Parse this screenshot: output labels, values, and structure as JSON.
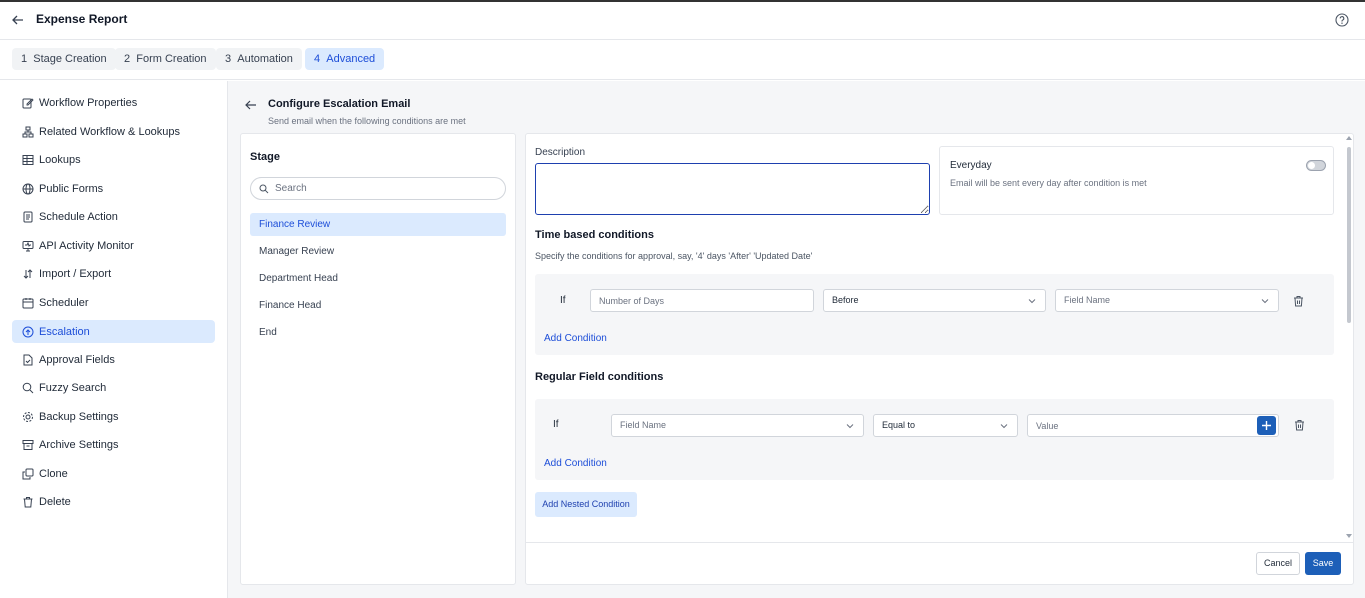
{
  "header": {
    "title": "Expense Report"
  },
  "steps": [
    {
      "num": "1",
      "label": "Stage Creation"
    },
    {
      "num": "2",
      "label": "Form Creation"
    },
    {
      "num": "3",
      "label": "Automation"
    },
    {
      "num": "4",
      "label": "Advanced"
    }
  ],
  "sidebar": {
    "items": [
      {
        "label": "Workflow Properties",
        "icon": "edit-icon"
      },
      {
        "label": "Related Workflow & Lookups",
        "icon": "hierarchy-icon"
      },
      {
        "label": "Lookups",
        "icon": "table-icon"
      },
      {
        "label": "Public Forms",
        "icon": "globe-icon"
      },
      {
        "label": "Schedule Action",
        "icon": "document-icon"
      },
      {
        "label": "API Activity Monitor",
        "icon": "monitor-icon"
      },
      {
        "label": "Import / Export",
        "icon": "import-export-icon"
      },
      {
        "label": "Scheduler",
        "icon": "calendar-icon"
      },
      {
        "label": "Escalation",
        "icon": "escalation-icon"
      },
      {
        "label": "Approval Fields",
        "icon": "file-check-icon"
      },
      {
        "label": "Fuzzy Search",
        "icon": "search-icon"
      },
      {
        "label": "Backup Settings",
        "icon": "gear-icon"
      },
      {
        "label": "Archive Settings",
        "icon": "archive-icon"
      },
      {
        "label": "Clone",
        "icon": "clone-icon"
      },
      {
        "label": "Delete",
        "icon": "trash-icon"
      }
    ]
  },
  "config": {
    "title": "Configure Escalation Email",
    "subtitle": "Send email when the following conditions are met"
  },
  "stage": {
    "label": "Stage",
    "search_placeholder": "Search",
    "items": [
      "Finance Review",
      "Manager Review",
      "Department Head",
      "Finance Head",
      "End"
    ]
  },
  "form": {
    "description_label": "Description",
    "everyday_title": "Everyday",
    "everyday_sub": "Email will be sent every day after condition is met",
    "time_title": "Time based conditions",
    "time_sub": "Specify the conditions for approval, say, '4' days 'After' 'Updated Date'",
    "if_label": "If",
    "days_placeholder": "Number of Days",
    "before_value": "Before",
    "field_name_placeholder": "Field Name",
    "add_condition": "Add Condition",
    "regular_title": "Regular Field conditions",
    "equal_value": "Equal to",
    "value_placeholder": "Value",
    "add_nested": "Add Nested Condition",
    "cancel": "Cancel",
    "save": "Save"
  }
}
